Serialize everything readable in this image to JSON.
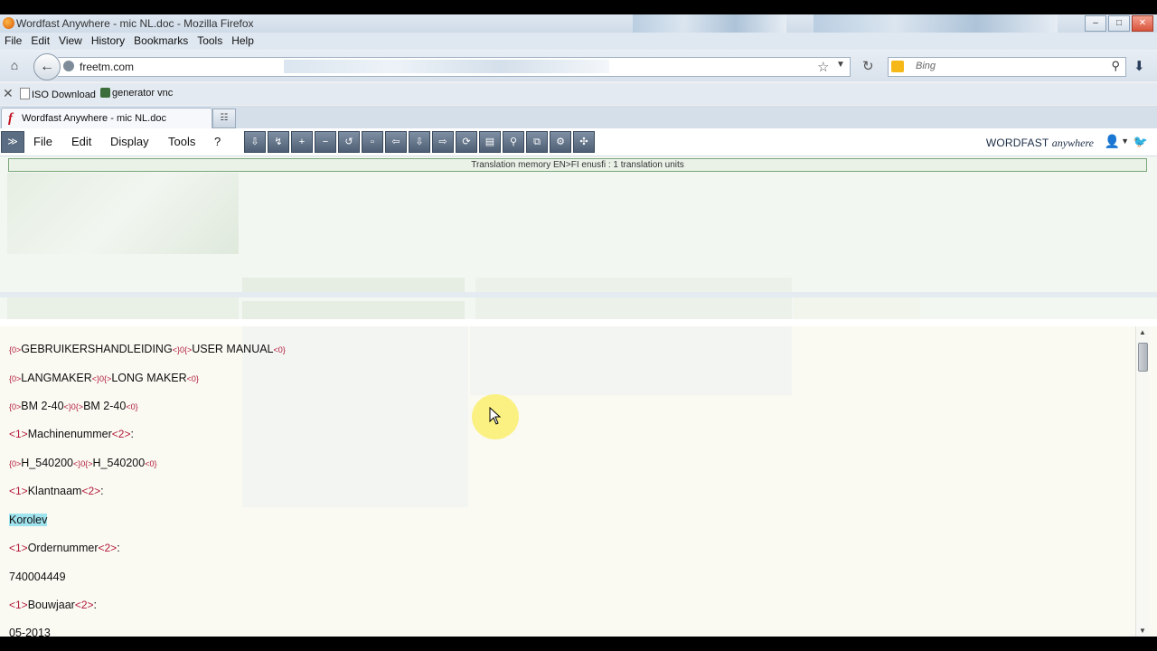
{
  "window": {
    "title": "Wordfast Anywhere - mic NL.doc - Mozilla Firefox",
    "buttons": [
      "–",
      "□",
      "✕"
    ]
  },
  "menubar": [
    "File",
    "Edit",
    "View",
    "History",
    "Bookmarks",
    "Tools",
    "Help"
  ],
  "navbar": {
    "url": "freetm.com",
    "search_placeholder": "Bing"
  },
  "bookmarks": [
    {
      "label": "ISO Download"
    },
    {
      "label": "generator vnc"
    }
  ],
  "tab": {
    "label": "Wordfast Anywhere - mic NL.doc"
  },
  "app": {
    "menu": [
      "File",
      "Edit",
      "Display",
      "Tools",
      "?"
    ],
    "brand_main": "WORDFAST",
    "brand_sub": "anywhere",
    "tm_header": "Translation memory EN>FI enusfi : 1 translation units"
  },
  "segments": [
    {
      "pre": "{0>",
      "text1": "GEBRUIKERSHANDLEIDING",
      "mid": "<}0{>",
      "text2": "USER MANUAL",
      "post": "<0}"
    },
    {
      "pre": "{0>",
      "text1": "LANGMAKER",
      "mid": "<}0{>",
      "text2": "LONG MAKER",
      "post": "<0}"
    },
    {
      "pre": "{0>",
      "text1": "BM 2-40",
      "mid": "<}0{>",
      "text2": "BM 2-40",
      "post": "<0}"
    },
    {
      "pre": "<1>",
      "text1": "Machinenummer",
      "mid": "<2>",
      "text2": ":"
    },
    {
      "pre": "{0>",
      "text1": "H_540200",
      "mid": "<}0{>",
      "text2": "H_540200",
      "post": "<0}"
    },
    {
      "pre": "<1>",
      "text1": "Klantnaam",
      "mid": "<2>",
      "text2": ":"
    },
    {
      "text1": "Korolev"
    },
    {
      "pre": "<1>",
      "text1": "Ordernummer",
      "mid": "<2>",
      "text2": ":"
    },
    {
      "text1": "740004449"
    },
    {
      "pre": "<1>",
      "text1": "Bouwjaar",
      "mid": "<2>",
      "text2": ":"
    },
    {
      "text1": "05-2013"
    }
  ]
}
